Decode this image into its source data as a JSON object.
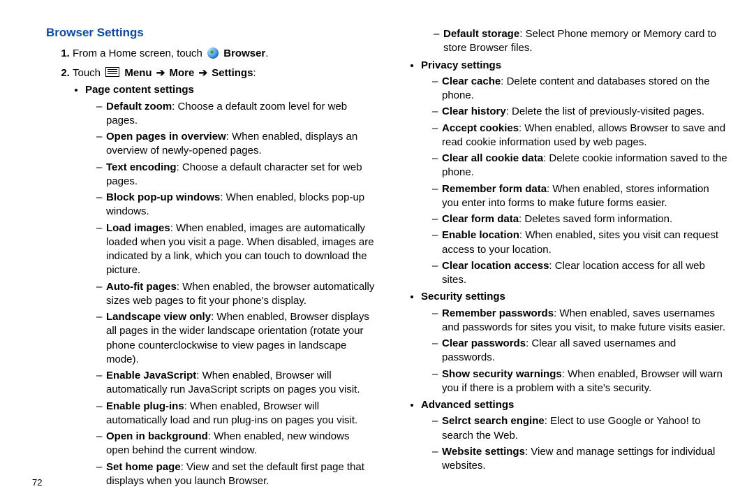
{
  "page_number": "72",
  "title": "Browser Settings",
  "steps": {
    "1": {
      "prefix": "From a Home screen, touch ",
      "app": "Browser",
      "suffix": "."
    },
    "2": {
      "prefix": "Touch ",
      "menu": "Menu",
      "arrow": "➔",
      "more": "More",
      "settings": "Settings",
      "colon": ":"
    }
  },
  "page_content": {
    "heading": "Page content settings",
    "items": [
      {
        "label": "Default zoom",
        "text": "Choose a default zoom level for web pages."
      },
      {
        "label": "Open pages in overview",
        "text": "When enabled, displays an overview of newly-opened pages."
      },
      {
        "label": "Text encoding",
        "text": "Choose a default character set for web pages."
      },
      {
        "label": "Block pop-up windows",
        "text": "When enabled, blocks pop-up windows."
      },
      {
        "label": "Load images",
        "text": "When enabled, images are automatically loaded when you visit a page. When disabled, images are indicated by a link, which you can touch to download the picture."
      },
      {
        "label": "Auto-fit pages",
        "text": "When enabled, the browser automatically sizes web pages to fit your phone's display."
      },
      {
        "label": "Landscape view only",
        "text": "When enabled, Browser displays all pages in the wider landscape orientation (rotate your phone counterclockwise to view pages in landscape mode)."
      },
      {
        "label": "Enable JavaScript",
        "text": "When enabled, Browser will automatically run JavaScript scripts on pages you visit."
      },
      {
        "label": "Enable plug-ins",
        "text": "When enabled, Browser will automatically load and run plug-ins on pages you visit."
      },
      {
        "label": "Open in background",
        "text": "When enabled, new windows open behind the current window."
      },
      {
        "label": "Set home page",
        "text": "View and set the default first page that displays when you launch Browser."
      }
    ]
  },
  "page_content_tail": {
    "items": [
      {
        "label": "Default storage",
        "text": "Select Phone memory or Memory card to store Browser files."
      }
    ]
  },
  "privacy": {
    "heading": "Privacy settings",
    "items": [
      {
        "label": "Clear cache",
        "text": "Delete content and databases stored on the phone."
      },
      {
        "label": "Clear history",
        "text": "Delete the list of previously-visited pages."
      },
      {
        "label": "Accept cookies",
        "text": "When enabled, allows Browser to save and read cookie information used by web pages."
      },
      {
        "label": "Clear all cookie data",
        "text": "Delete cookie information saved to the phone."
      },
      {
        "label": "Remember form data",
        "text": "When enabled, stores information you enter into forms to make future forms easier."
      },
      {
        "label": "Clear form data",
        "text": "Deletes saved form information."
      },
      {
        "label": "Enable location",
        "text": "When enabled, sites you visit can request access to your location."
      },
      {
        "label": "Clear location access",
        "text": "Clear location access for all web sites."
      }
    ]
  },
  "security": {
    "heading": "Security settings",
    "items": [
      {
        "label": "Remember passwords",
        "text": "When enabled, saves usernames and passwords for sites you visit, to make future visits easier."
      },
      {
        "label": "Clear passwords",
        "text": "Clear all saved usernames and passwords."
      },
      {
        "label": "Show security warnings",
        "text": "When enabled, Browser will warn you if there is a problem with a site's security."
      }
    ]
  },
  "advanced": {
    "heading": "Advanced settings",
    "items": [
      {
        "label": "Selrct search engine",
        "text": "Elect to use Google or Yahoo! to search the Web."
      },
      {
        "label": "Website settings",
        "text": "View and manage settings for individual websites."
      }
    ]
  }
}
